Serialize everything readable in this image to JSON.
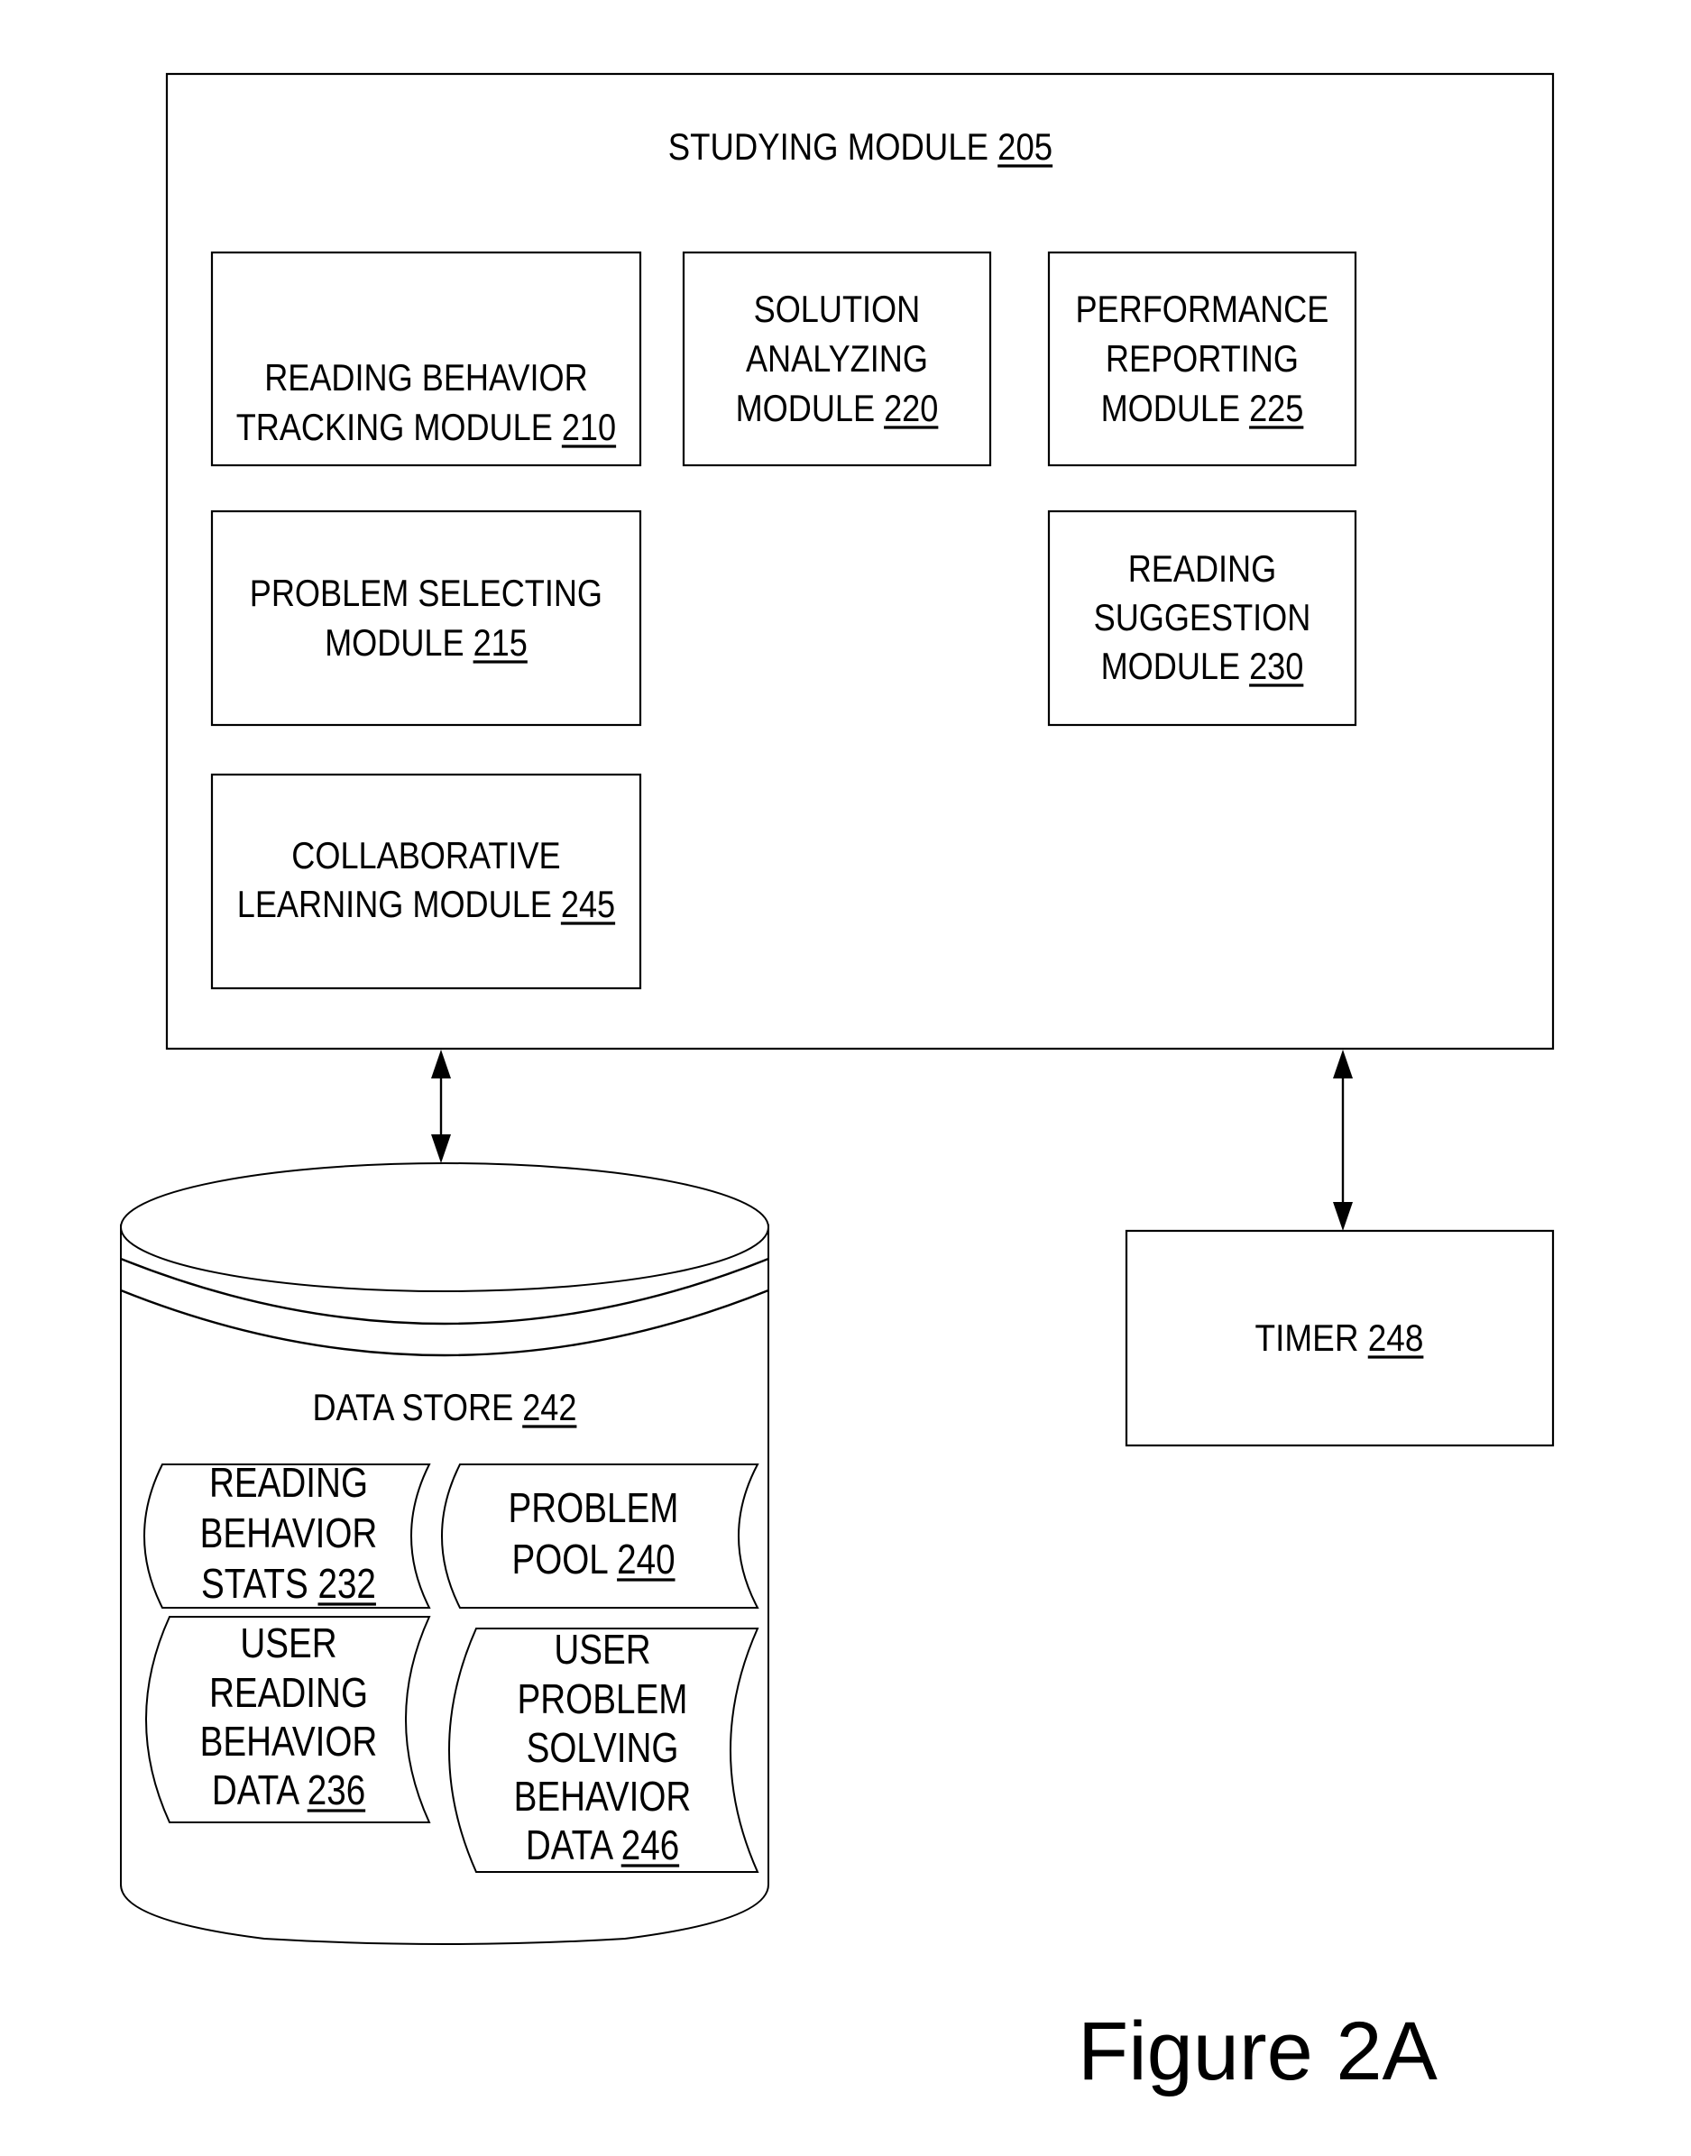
{
  "figure_label": "Figure 2A",
  "studying_module": {
    "name": "STUDYING MODULE",
    "ref": "205",
    "submodules": [
      {
        "key": "reading-behavior-tracking",
        "lines": [
          "READING BEHAVIOR",
          "TRACKING MODULE"
        ],
        "ref": "210"
      },
      {
        "key": "solution-analyzing",
        "lines": [
          "SOLUTION",
          "ANALYZING",
          "MODULE"
        ],
        "ref": "220"
      },
      {
        "key": "performance-reporting",
        "lines": [
          "PERFORMANCE",
          "REPORTING",
          "MODULE"
        ],
        "ref": "225"
      },
      {
        "key": "problem-selecting",
        "lines": [
          "PROBLEM SELECTING",
          "MODULE"
        ],
        "ref": "215"
      },
      {
        "key": "reading-suggestion",
        "lines": [
          "READING",
          "SUGGESTION",
          "MODULE"
        ],
        "ref": "230"
      },
      {
        "key": "collaborative-learning",
        "lines": [
          "COLLABORATIVE",
          "LEARNING MODULE"
        ],
        "ref": "245"
      }
    ]
  },
  "data_store": {
    "name": "DATA STORE",
    "ref": "242",
    "items": [
      {
        "key": "reading-behavior-stats",
        "lines": [
          "READING",
          "BEHAVIOR",
          "STATS"
        ],
        "ref": "232"
      },
      {
        "key": "problem-pool",
        "lines": [
          "PROBLEM",
          "POOL"
        ],
        "ref": "240"
      },
      {
        "key": "user-reading-behavior-data",
        "lines": [
          "USER",
          "READING",
          "BEHAVIOR",
          "DATA"
        ],
        "ref": "236"
      },
      {
        "key": "user-problem-solving-behavior-data",
        "lines": [
          "USER",
          "PROBLEM",
          "SOLVING",
          "BEHAVIOR",
          "DATA"
        ],
        "ref": "246"
      }
    ]
  },
  "timer": {
    "name": "TIMER",
    "ref": "248"
  },
  "connections": [
    {
      "from": "studying-module",
      "to": "data-store",
      "direction": "bidirectional"
    },
    {
      "from": "studying-module",
      "to": "timer",
      "direction": "bidirectional"
    }
  ]
}
